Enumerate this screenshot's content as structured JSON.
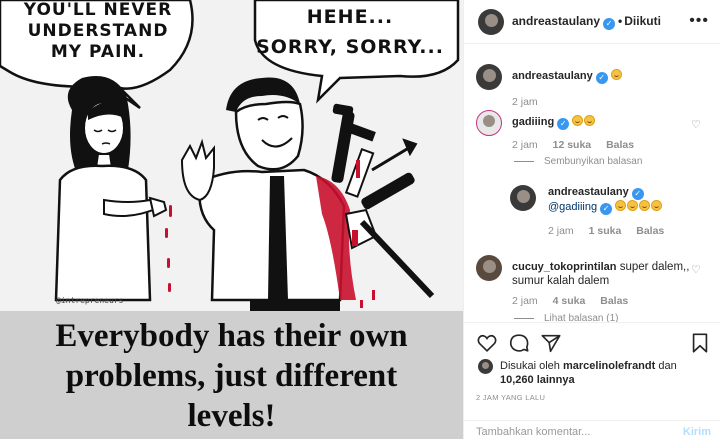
{
  "post_image": {
    "bubble_left_lines": [
      "YOU'LL NEVER",
      "UNDERSTAND",
      "MY PAIN."
    ],
    "bubble_right_lines": [
      "HEHE...",
      "SORRY, SORRY..."
    ],
    "watermark": "@intrepreneurs",
    "caption_lines": [
      "Everybody has their own",
      "problems, just different",
      "levels!"
    ]
  },
  "header": {
    "username": "andreastaulany",
    "separator": "•",
    "follow_status": "Diikuti"
  },
  "comments": [
    {
      "username": "andreastaulany",
      "text": "",
      "emoji_count": 1,
      "time": "2 jam"
    },
    {
      "username": "gadiiing",
      "text": "",
      "emoji_count": 2,
      "time": "2 jam",
      "likes": "12 suka",
      "reply": "Balas",
      "replies_toggle": "Sembunyikan balasan"
    },
    {
      "username": "andreastaulany",
      "mention": "@gadiiing",
      "emoji_count": 4,
      "time": "2 jam",
      "likes": "1 suka",
      "reply": "Balas"
    },
    {
      "username": "cucuy_tokoprintilan",
      "text": "super dalem,, sumur kalah dalem",
      "time": "2 jam",
      "likes": "4 suka",
      "reply": "Balas",
      "replies_toggle": "Lihat balasan (1)"
    }
  ],
  "likes": {
    "prefix": "Disukai oleh",
    "user": "marcelinolefrandt",
    "conjunction": "dan",
    "others": "10,260 lainnya"
  },
  "time_ago": "2 JAM YANG LALU",
  "add_comment": {
    "placeholder": "Tambahkan komentar...",
    "post_label": "Kirim"
  },
  "colors": {
    "verified": "#3897f0",
    "muted": "#8e8e8e",
    "post_button": "#b2dffc",
    "blood": "#c8102e"
  }
}
